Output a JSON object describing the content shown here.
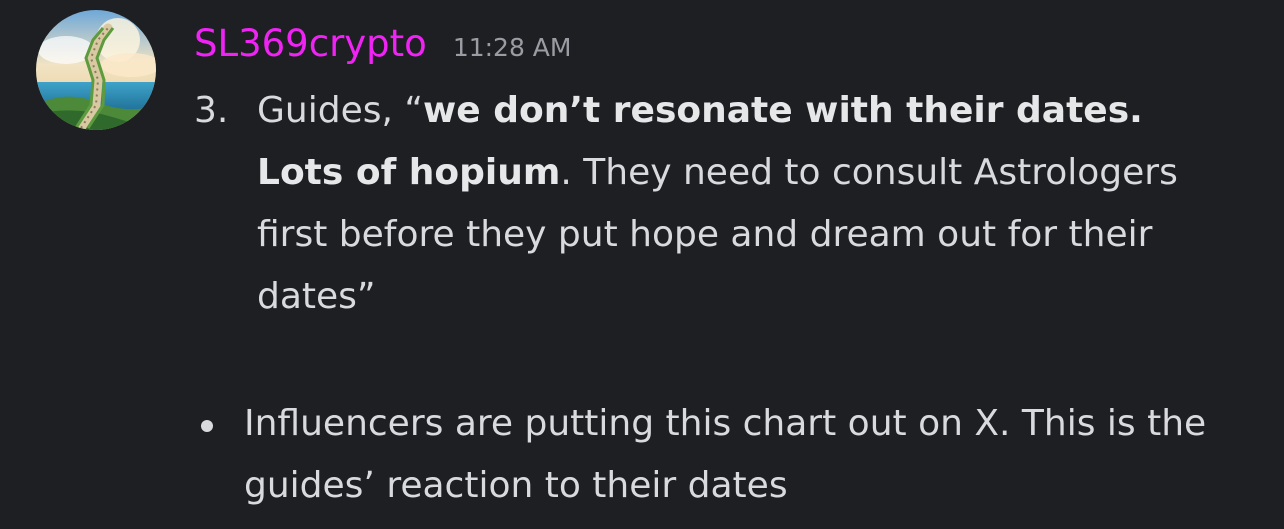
{
  "author": {
    "username": "SL369crypto",
    "timestamp": "11:28 AM",
    "username_color": "#f023f5",
    "avatar_icon": "stairway-to-heaven-avatar"
  },
  "message": {
    "ordered_item": {
      "number": "3.",
      "prefix": "Guides, “",
      "bold1": "we don’t resonate with their dates.",
      "bold2": "Lots of hopium",
      "rest": ". They need to consult Astrologers first before they put hope and dream out for their dates”"
    },
    "bullet_item": {
      "text": "Influencers are putting this chart out on X. This is the guides’ reaction to their dates"
    }
  }
}
